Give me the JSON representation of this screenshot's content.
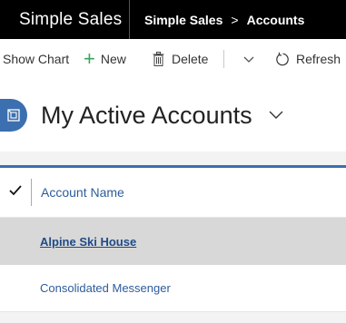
{
  "topbar": {
    "app_name": "Simple Sales",
    "breadcrumb": {
      "root": "Simple Sales",
      "separator": ">",
      "current": "Accounts"
    }
  },
  "commands": {
    "show_chart": "Show Chart",
    "new": "New",
    "delete": "Delete",
    "refresh": "Refresh",
    "icons": {
      "new": "plus-icon",
      "delete": "trash-icon",
      "more": "chevron-down-icon",
      "refresh": "refresh-icon"
    }
  },
  "view": {
    "title": "My Active Accounts",
    "entity_icon": "account-entity-icon",
    "selector_icon": "chevron-down-icon"
  },
  "grid": {
    "select_all_icon": "checkmark-icon",
    "columns": [
      "Account Name"
    ],
    "rows": [
      {
        "account_name": "Alpine Ski House",
        "selected": true
      },
      {
        "account_name": "Consolidated Messenger",
        "selected": false
      }
    ]
  },
  "colors": {
    "accent": "#3b6fb0",
    "new_icon": "#3aa35a",
    "link": "#2d5c9b",
    "topbar": "#000000"
  }
}
